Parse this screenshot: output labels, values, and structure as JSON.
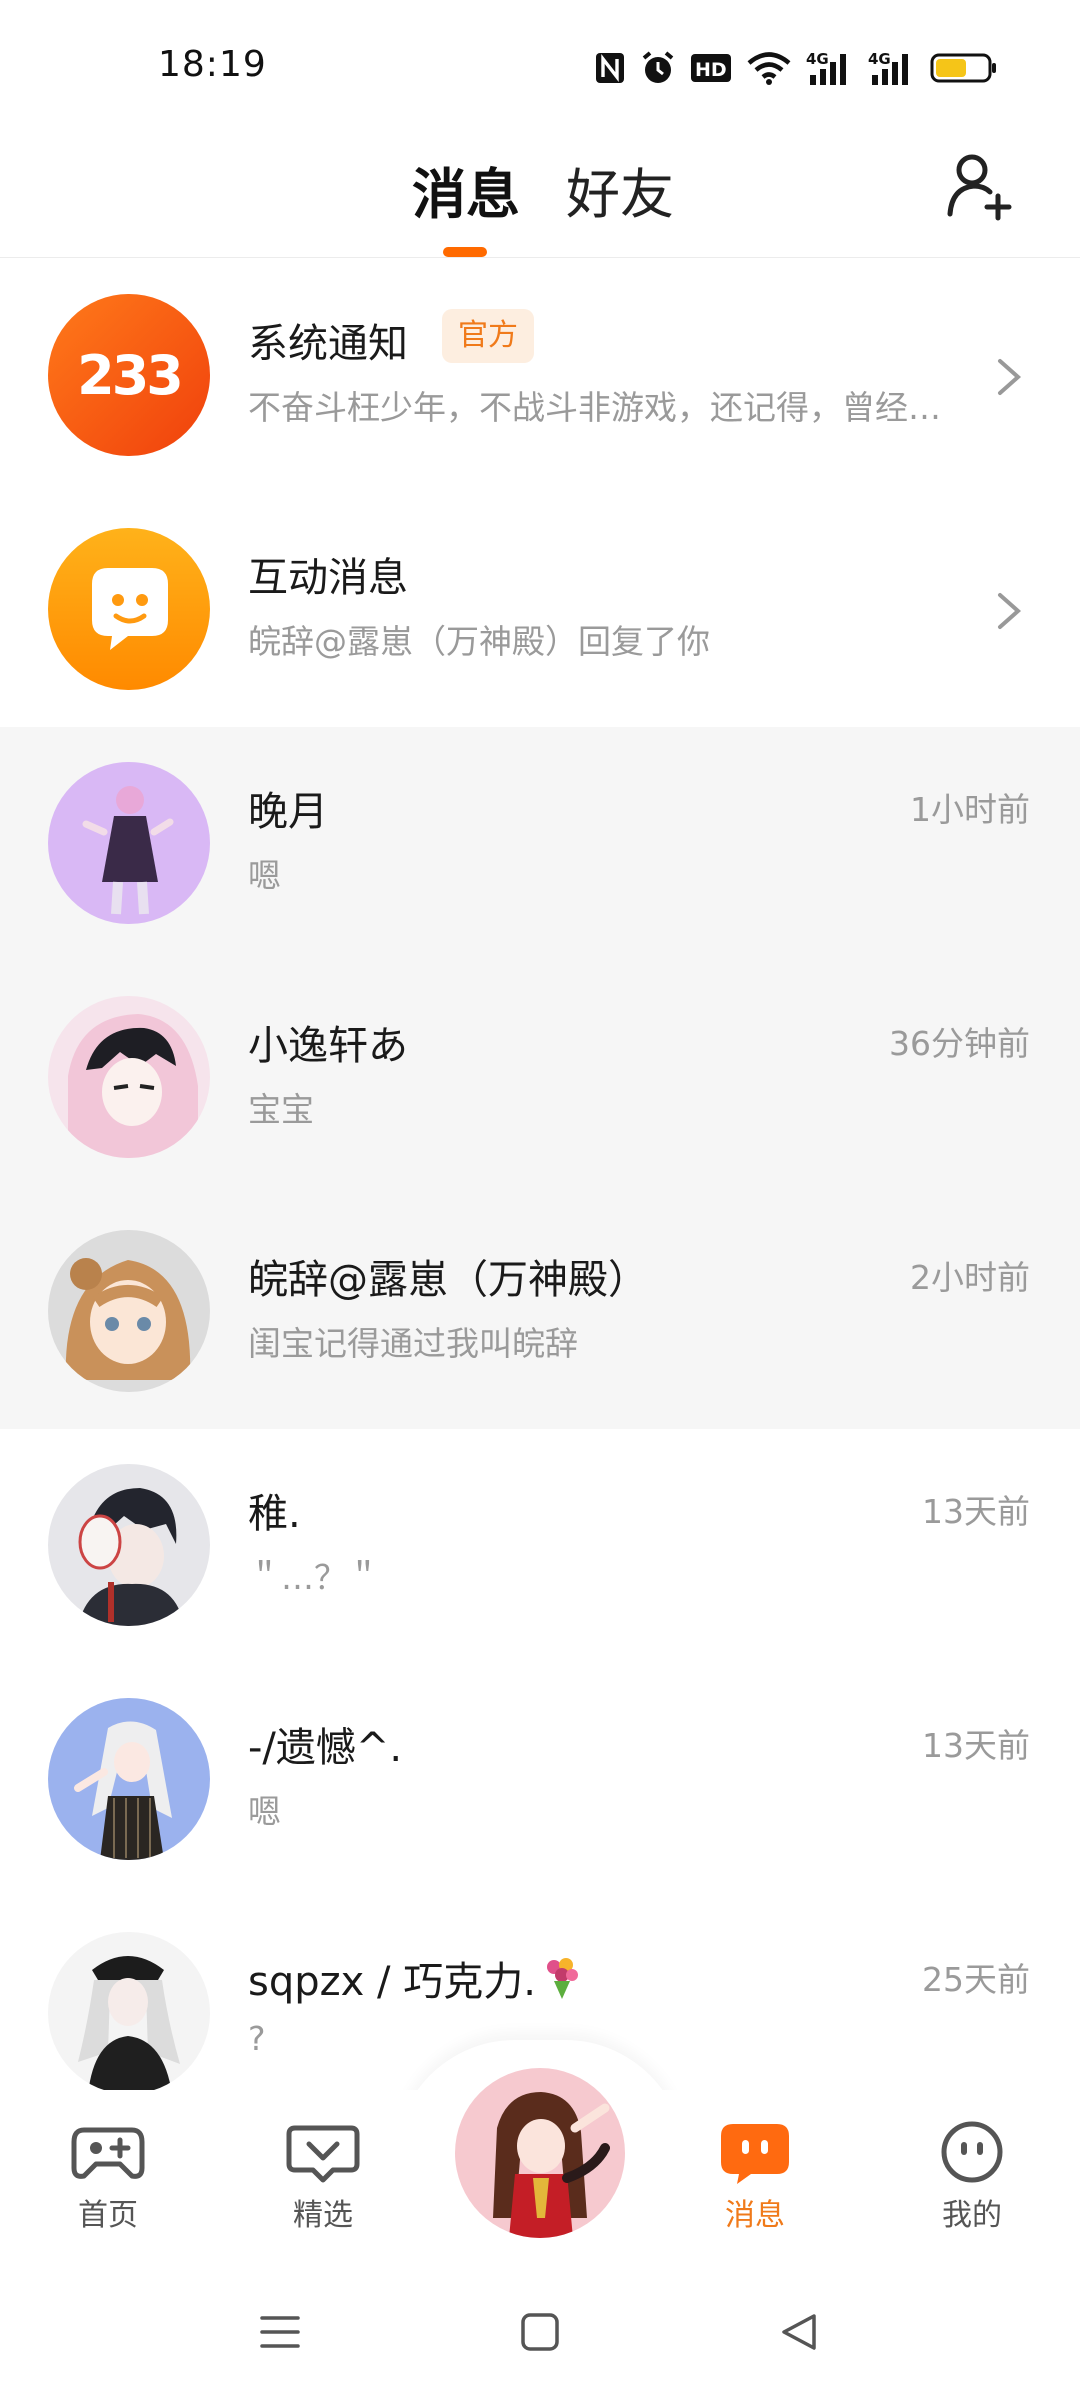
{
  "status_bar": {
    "time": "18:19",
    "icons": [
      "nfc-icon",
      "alarm-icon",
      "hd-icon",
      "wifi-icon",
      "signal-4g-icon",
      "signal-4g-icon",
      "battery-icon"
    ],
    "network_label": "4G",
    "hd_label": "HD",
    "battery_color": "#f5c518"
  },
  "header": {
    "tabs": [
      {
        "label": "消息",
        "active": true
      },
      {
        "label": "好友",
        "active": false
      }
    ],
    "accent_color": "#ff6a00"
  },
  "conversations": [
    {
      "name": "系统通知",
      "badge": "官方",
      "preview": "不奋斗枉少年，不战斗非游戏，还记得，曾经的你吗？",
      "time": "",
      "avatar_text": "233"
    },
    {
      "name": "互动消息",
      "badge": "",
      "preview": "皖辞@露崽（万神殿）回复了你",
      "time": ""
    },
    {
      "name": "晚月",
      "preview": "嗯",
      "time": "1小时前"
    },
    {
      "name": "小逸轩あ",
      "preview": "宝宝",
      "time": "36分钟前"
    },
    {
      "name": "皖辞@露崽（万神殿）",
      "preview": "闺宝记得通过我叫皖辞",
      "time": "2小时前"
    },
    {
      "name": "稚.",
      "preview": "＂…？＂",
      "time": "13天前"
    },
    {
      "name": "-/遗憾^.",
      "preview": "嗯",
      "time": "13天前"
    },
    {
      "name": "sqpzx / 巧克力.",
      "preview": "?",
      "time": "25天前"
    }
  ],
  "bottom_nav": [
    {
      "label": "首页",
      "icon": "gamepad-icon",
      "active": false
    },
    {
      "label": "精选",
      "icon": "heart-chat-icon",
      "active": false
    },
    {
      "label": "消息",
      "icon": "message-bubble-icon",
      "active": true
    },
    {
      "label": "我的",
      "icon": "smiley-icon",
      "active": false
    }
  ]
}
